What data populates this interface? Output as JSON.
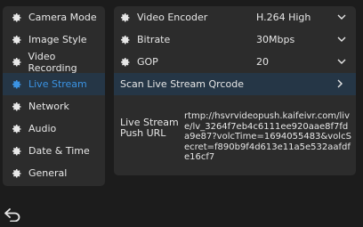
{
  "sidebar": {
    "items": [
      {
        "label": "Camera Mode",
        "icon": "gear-icon",
        "active": false
      },
      {
        "label": "Image Style",
        "icon": "gear-icon",
        "active": false
      },
      {
        "label": "Video Recording",
        "icon": "gear-icon",
        "active": false
      },
      {
        "label": "Live Stream",
        "icon": "gear-icon",
        "active": true
      },
      {
        "label": "Network",
        "icon": "gear-icon",
        "active": false
      },
      {
        "label": "Audio",
        "icon": "gear-icon",
        "active": false
      },
      {
        "label": "Date & Time",
        "icon": "gear-icon",
        "active": false
      },
      {
        "label": "General",
        "icon": "gear-icon",
        "active": false
      }
    ]
  },
  "settings": {
    "video_encoder": {
      "label": "Video Encoder",
      "value": "H.264 High"
    },
    "bitrate": {
      "label": "Bitrate",
      "value": "30Mbps"
    },
    "gop": {
      "label": "GOP",
      "value": "20"
    },
    "scan_qrcode": {
      "label": "Scan Live Stream Qrcode"
    },
    "push_url": {
      "label": "Live Stream Push URL",
      "value": "rtmp://hsvrvideopush.kaifeivr.com/live/lv_3264f7eb4c6111ee920aae8f7fda9e87?volcTime=1694055483&volcSecret=f890b9f4d613e11a5e532aafdfe16cf7"
    }
  },
  "footer": {
    "back_icon": "back-arrow-icon"
  },
  "colors": {
    "accent": "#3b93e3",
    "panel": "#2c2c2c",
    "background": "#1c1c1c",
    "active_row": "#253646"
  }
}
